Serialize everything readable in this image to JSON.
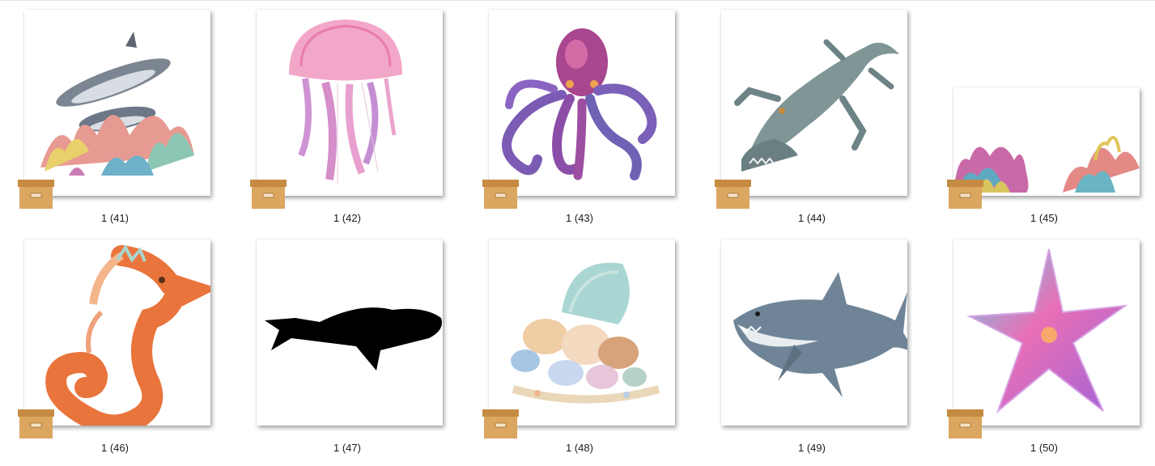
{
  "files": [
    {
      "name": "1 (41)",
      "subject": "dolphins-coral"
    },
    {
      "name": "1 (42)",
      "subject": "jellyfish"
    },
    {
      "name": "1 (43)",
      "subject": "octopus"
    },
    {
      "name": "1 (44)",
      "subject": "crocodile"
    },
    {
      "name": "1 (45)",
      "subject": "coral-reef"
    },
    {
      "name": "1 (46)",
      "subject": "seahorse"
    },
    {
      "name": "1 (47)",
      "subject": "whale-silhouette"
    },
    {
      "name": "1 (48)",
      "subject": "seashells"
    },
    {
      "name": "1 (49)",
      "subject": "shark"
    },
    {
      "name": "1 (50)",
      "subject": "starfish"
    }
  ],
  "overlay_icon": "archive-box-icon",
  "colors": {
    "archive_box": "#d9a35c",
    "archive_box_dark": "#b8813d",
    "label_text": "#1a1a1a"
  }
}
